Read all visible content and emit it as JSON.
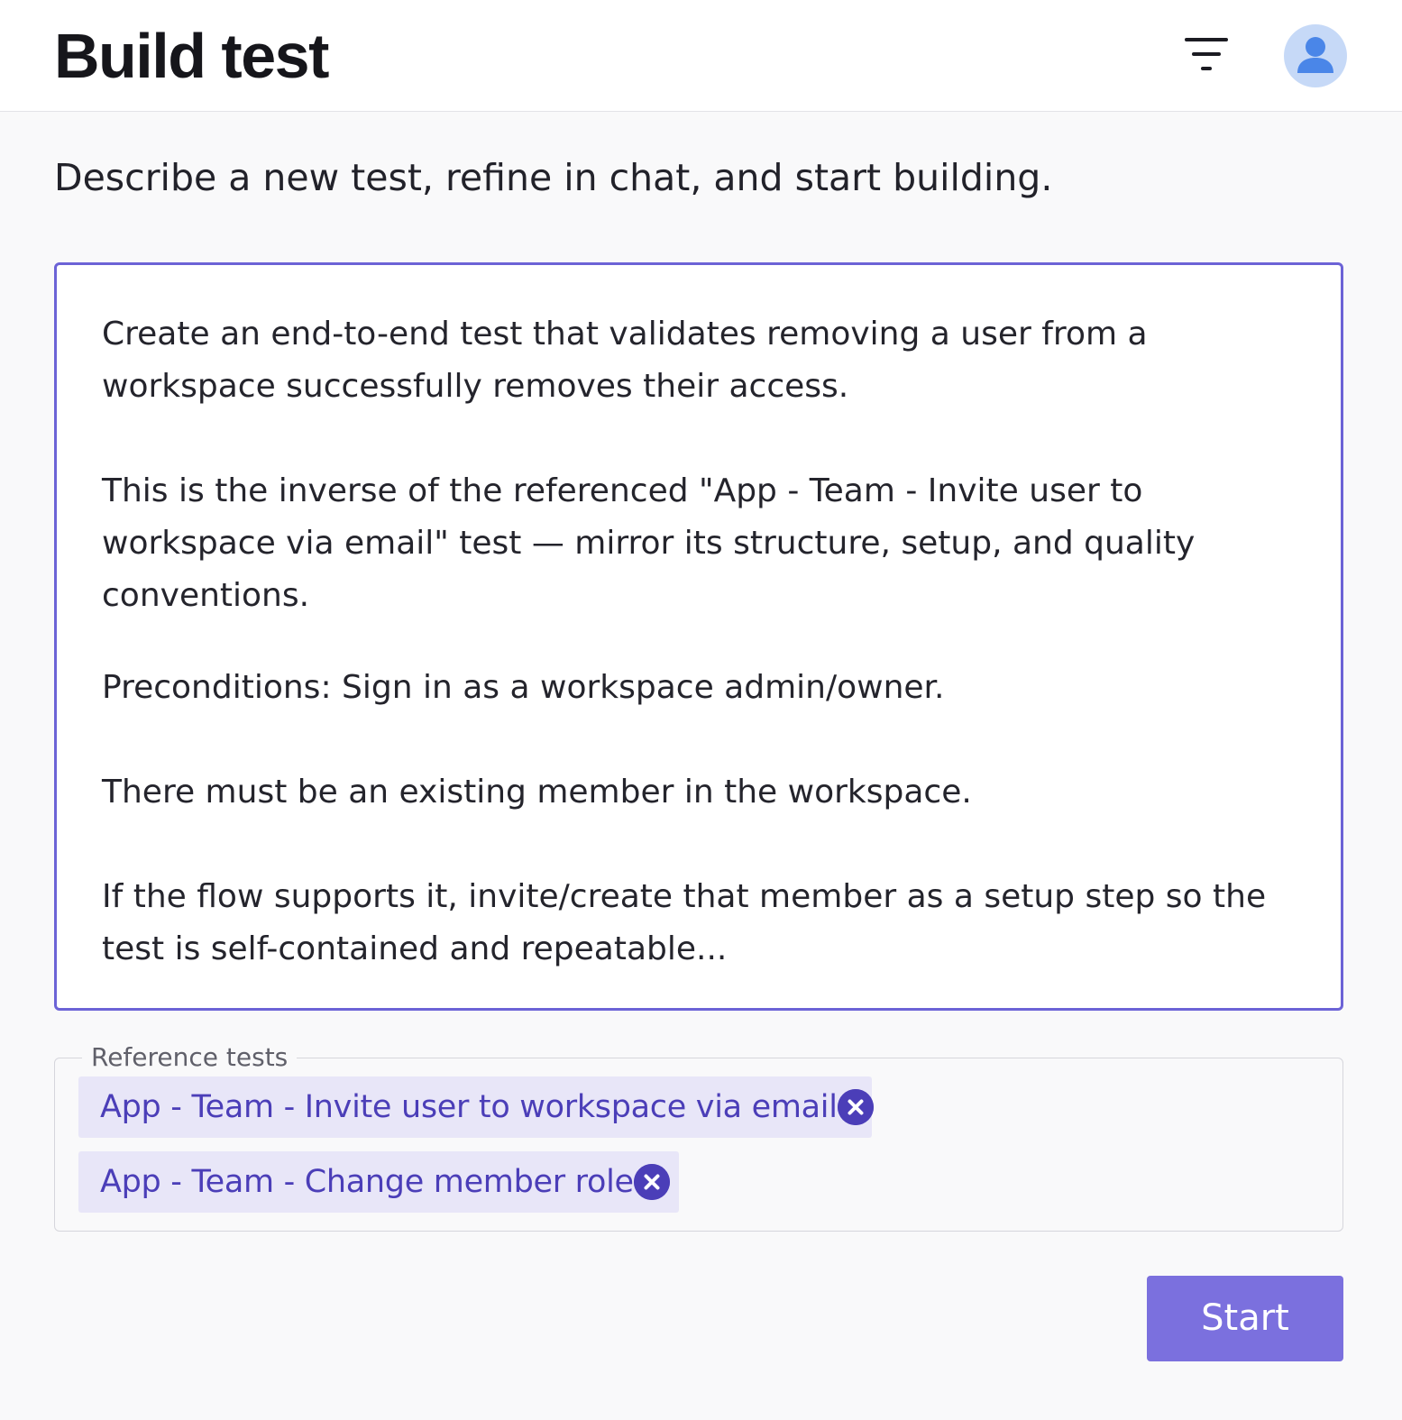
{
  "header": {
    "title": "Build test",
    "filter_icon": "filter-icon",
    "avatar_icon": "user-icon"
  },
  "subtitle": "Describe a new test, refine in chat, and start building.",
  "prompt": {
    "paragraphs": [
      "Create an end-to-end test that validates removing a user from a workspace successfully removes their access.",
      "This is the inverse of the referenced \"App - Team - Invite user to workspace via email\" test — mirror its structure, setup, and quality conventions.",
      "Preconditions: Sign in as a workspace admin/owner.",
      "There must be an existing member in the workspace.",
      "If the flow supports it, invite/create that member as a setup step so the test is self-contained and repeatable..."
    ]
  },
  "reference_tests": {
    "legend": "Reference tests",
    "chips": [
      {
        "label": "App - Team - Invite user to workspace via email",
        "remove_icon": "close-circle-icon"
      },
      {
        "label": "App - Team - Change member role",
        "remove_icon": "close-circle-icon"
      }
    ]
  },
  "actions": {
    "start_label": "Start"
  },
  "colors": {
    "accent": "#6c63d6",
    "button": "#7b70de",
    "chip_bg": "#e8e6f8",
    "chip_text": "#4b3eb8",
    "avatar_bg": "#c6d9f7",
    "avatar_fg": "#4a86e8"
  }
}
